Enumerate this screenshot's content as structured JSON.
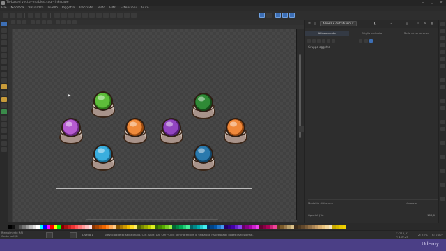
{
  "window": {
    "title": "Tir-based vector-enabled.svg - Inkscape",
    "app_icon": "inkscape-icon"
  },
  "menu": [
    "File",
    "Modifica",
    "Visualizza",
    "Livello",
    "Oggetto",
    "Tracciato",
    "Testo",
    "Filtri",
    "Estensioni",
    "Aiuto"
  ],
  "dock": {
    "active_tab": "Allinea e distribuisci",
    "subtabs": [
      "Allineamento",
      "Griglia ordinata",
      "Sulla circonferenza"
    ],
    "object_label": "Gruppo oggetto",
    "blend_label": "Modalità di fusione",
    "blend_value": "Normale",
    "opacity_label": "Opacità (%)",
    "opacity_value": "100,0"
  },
  "status": {
    "fill_label": "Riempimento",
    "stroke_label": "Contorno",
    "fill_value": "N/D",
    "stroke_value": "N/D",
    "layer": "Livello 1",
    "message": "Stesso oggetto selezionato. Ctrl, Shift, Alt, Ctrl+Click per ingrandire la selezione rispetto agli oggetti selezionati.",
    "x_label": "X:",
    "x_value": "212,31",
    "y_label": "Y:",
    "y_value": "110,25",
    "zoom_label": "Z:",
    "zoom_value": "75%",
    "rotation_label": "R:",
    "rotation_value": "0,00°"
  },
  "brand": "Udemy",
  "colors": {
    "accent": "#4a82c8",
    "selection": "#bcbcbc",
    "video_bar": "#4b3f86",
    "buttons": [
      {
        "color": "#5ebd3a",
        "shade": "#2f7a1a"
      },
      {
        "color": "#b65bd0",
        "shade": "#6a2a80"
      },
      {
        "color": "#f08a3a",
        "shade": "#9a4a10"
      },
      {
        "color": "#9245c0",
        "shade": "#561f78"
      },
      {
        "color": "#3aaede",
        "shade": "#1b6f96"
      },
      {
        "color": "#2f8a36",
        "shade": "#164d1b"
      },
      {
        "color": "#f0883a",
        "shade": "#9a4a12"
      },
      {
        "color": "#2a79ad",
        "shade": "#12476b"
      }
    ],
    "palette": [
      "#000000",
      "#111111",
      "#333333",
      "#555555",
      "#777777",
      "#999999",
      "#bbbbbb",
      "#dddddd",
      "#ffffff",
      "#00ffff",
      "#0000ff",
      "#ff00ff",
      "#ff0000",
      "#ffff00",
      "#00ff00",
      "#800000",
      "#aa1111",
      "#cc2222",
      "#ee3333",
      "#ff5555",
      "#ff7777",
      "#ff9999",
      "#ffbbbb",
      "#ffdddd",
      "#883300",
      "#aa4400",
      "#cc5500",
      "#ee6600",
      "#ff8822",
      "#ffaa55",
      "#ffcc88",
      "#885500",
      "#aa7700",
      "#cc9900",
      "#eebb00",
      "#ffdd22",
      "#ffee66",
      "#556600",
      "#778800",
      "#99aa00",
      "#bbcc00",
      "#ddee22",
      "#336600",
      "#448800",
      "#55aa00",
      "#77cc22",
      "#99ee44",
      "#006633",
      "#008844",
      "#00aa55",
      "#22cc77",
      "#44ee99",
      "#006666",
      "#008888",
      "#00aaaa",
      "#22cccc",
      "#44eeee",
      "#003366",
      "#004488",
      "#0055aa",
      "#2277cc",
      "#4499ee",
      "#220066",
      "#330088",
      "#4400aa",
      "#6622cc",
      "#8844ee",
      "#660066",
      "#880088",
      "#aa00aa",
      "#cc22cc",
      "#ee44ee",
      "#660033",
      "#880044",
      "#aa0055",
      "#cc2277",
      "#ee4499",
      "#5a3a1a",
      "#7a5a2a",
      "#9a7a4a",
      "#baa06a",
      "#dac08a",
      "#3a2a1a",
      "#4e3a22",
      "#62482c",
      "#7a5c38",
      "#927046",
      "#aa8454",
      "#c29a62",
      "#dab070",
      "#e8c47e",
      "#f2d69a",
      "#f8e6bc",
      "#c8a800",
      "#d8b800",
      "#e8c800",
      "#f0d000"
    ]
  }
}
